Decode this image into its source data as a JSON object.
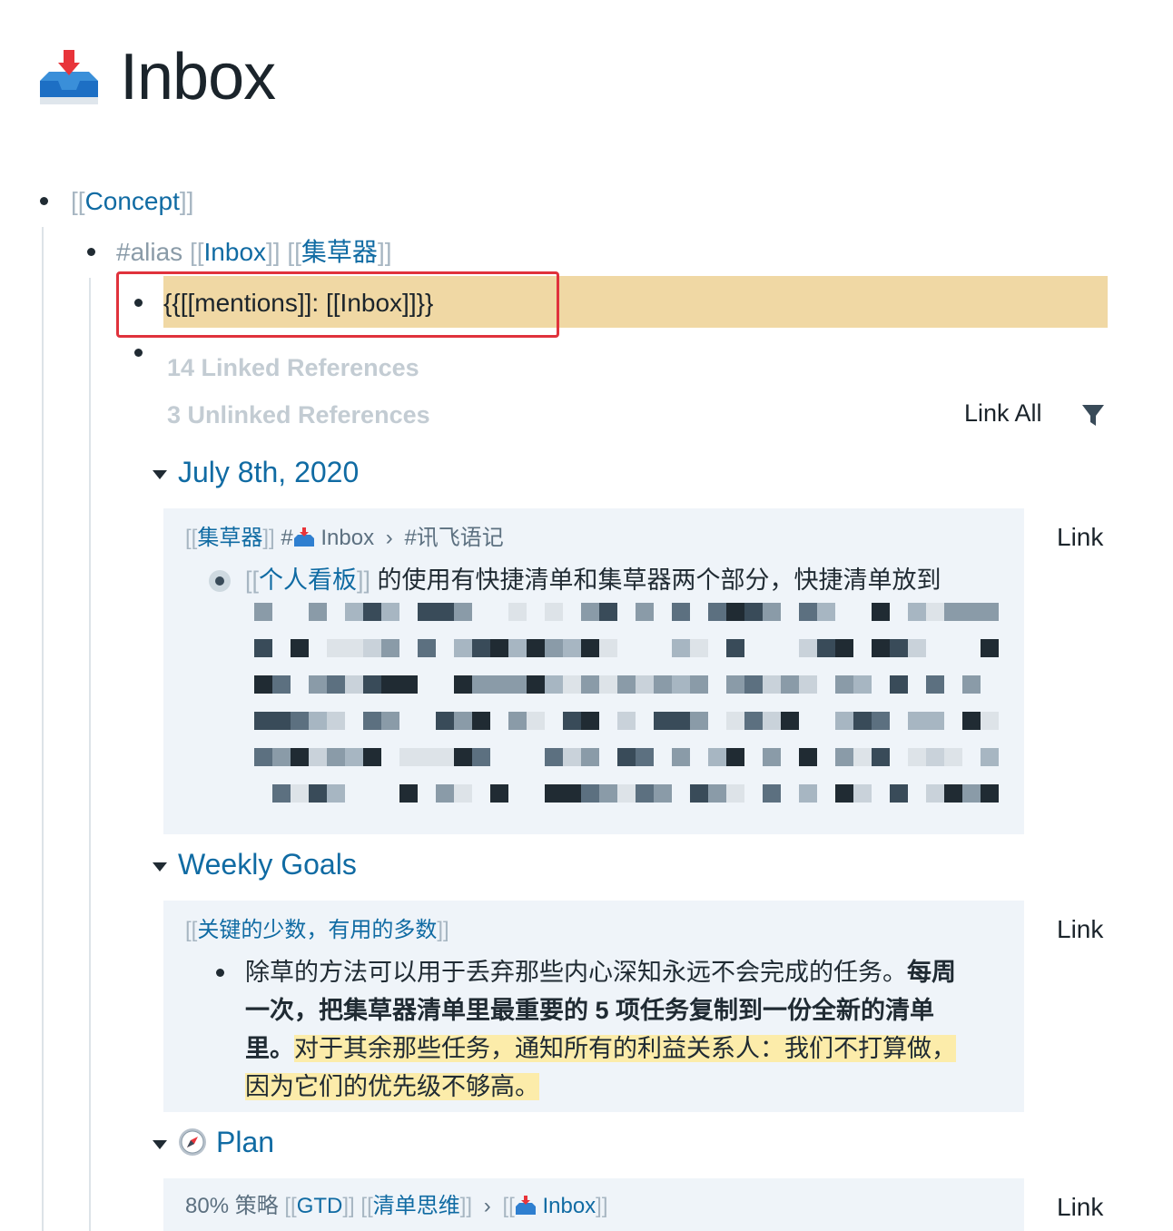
{
  "page": {
    "title": "Inbox",
    "title_icon": "inbox-tray-icon"
  },
  "tree": {
    "concept_open": "[[",
    "concept_label": "Concept",
    "concept_close": "]]",
    "alias_tag": "#alias",
    "alias_link1_label": "Inbox",
    "alias_link2_label": "集草器",
    "query_text": "{{[[mentions]]: [[Inbox]]}}"
  },
  "references": {
    "linked_label": "14 Linked References",
    "unlinked_label": "3 Unlinked References",
    "link_all_label": "Link All"
  },
  "groups": [
    {
      "title": "July 8th, 2020",
      "crumb": {
        "link1": "集草器",
        "tag": "#",
        "page": "Inbox",
        "sep": "›",
        "tag2": "#讯飞语记"
      },
      "body_link": "个人看板",
      "body_text": "的使用有快捷清单和集草器两个部分，快捷清单放到",
      "link_label": "Link"
    },
    {
      "title": "Weekly Goals",
      "crumb": {
        "link1": "关键的少数，有用的多数"
      },
      "body_line1_normal": "除草的方法可以用于丢弃那些内心深知永远不会完成的任务。",
      "body_line1_bold": "每周",
      "body_line2_bold": "一次，把集草器清单里最重要的 5 项任务复制到一份全新的清单",
      "body_line3_bold": "里。",
      "body_line3_hl": "对于其余那些任务，通知所有的利益关系人：我们不打算做，",
      "body_line4_hl": "因为它们的优先级不够高。",
      "link_label": "Link"
    },
    {
      "title": "Plan",
      "title_icon": "compass-icon",
      "crumb": {
        "prefix": "80% 策略",
        "link1": "GTD",
        "link2": "清单思维",
        "sep": "›",
        "page": "Inbox"
      },
      "link_label": "Link"
    }
  ],
  "colors": {
    "link": "#106ba3",
    "query_highlight": "#f0d8a4",
    "text_highlight": "#fcecaa",
    "red_box": "#e0323c",
    "card_bg": "#eff4f9"
  }
}
